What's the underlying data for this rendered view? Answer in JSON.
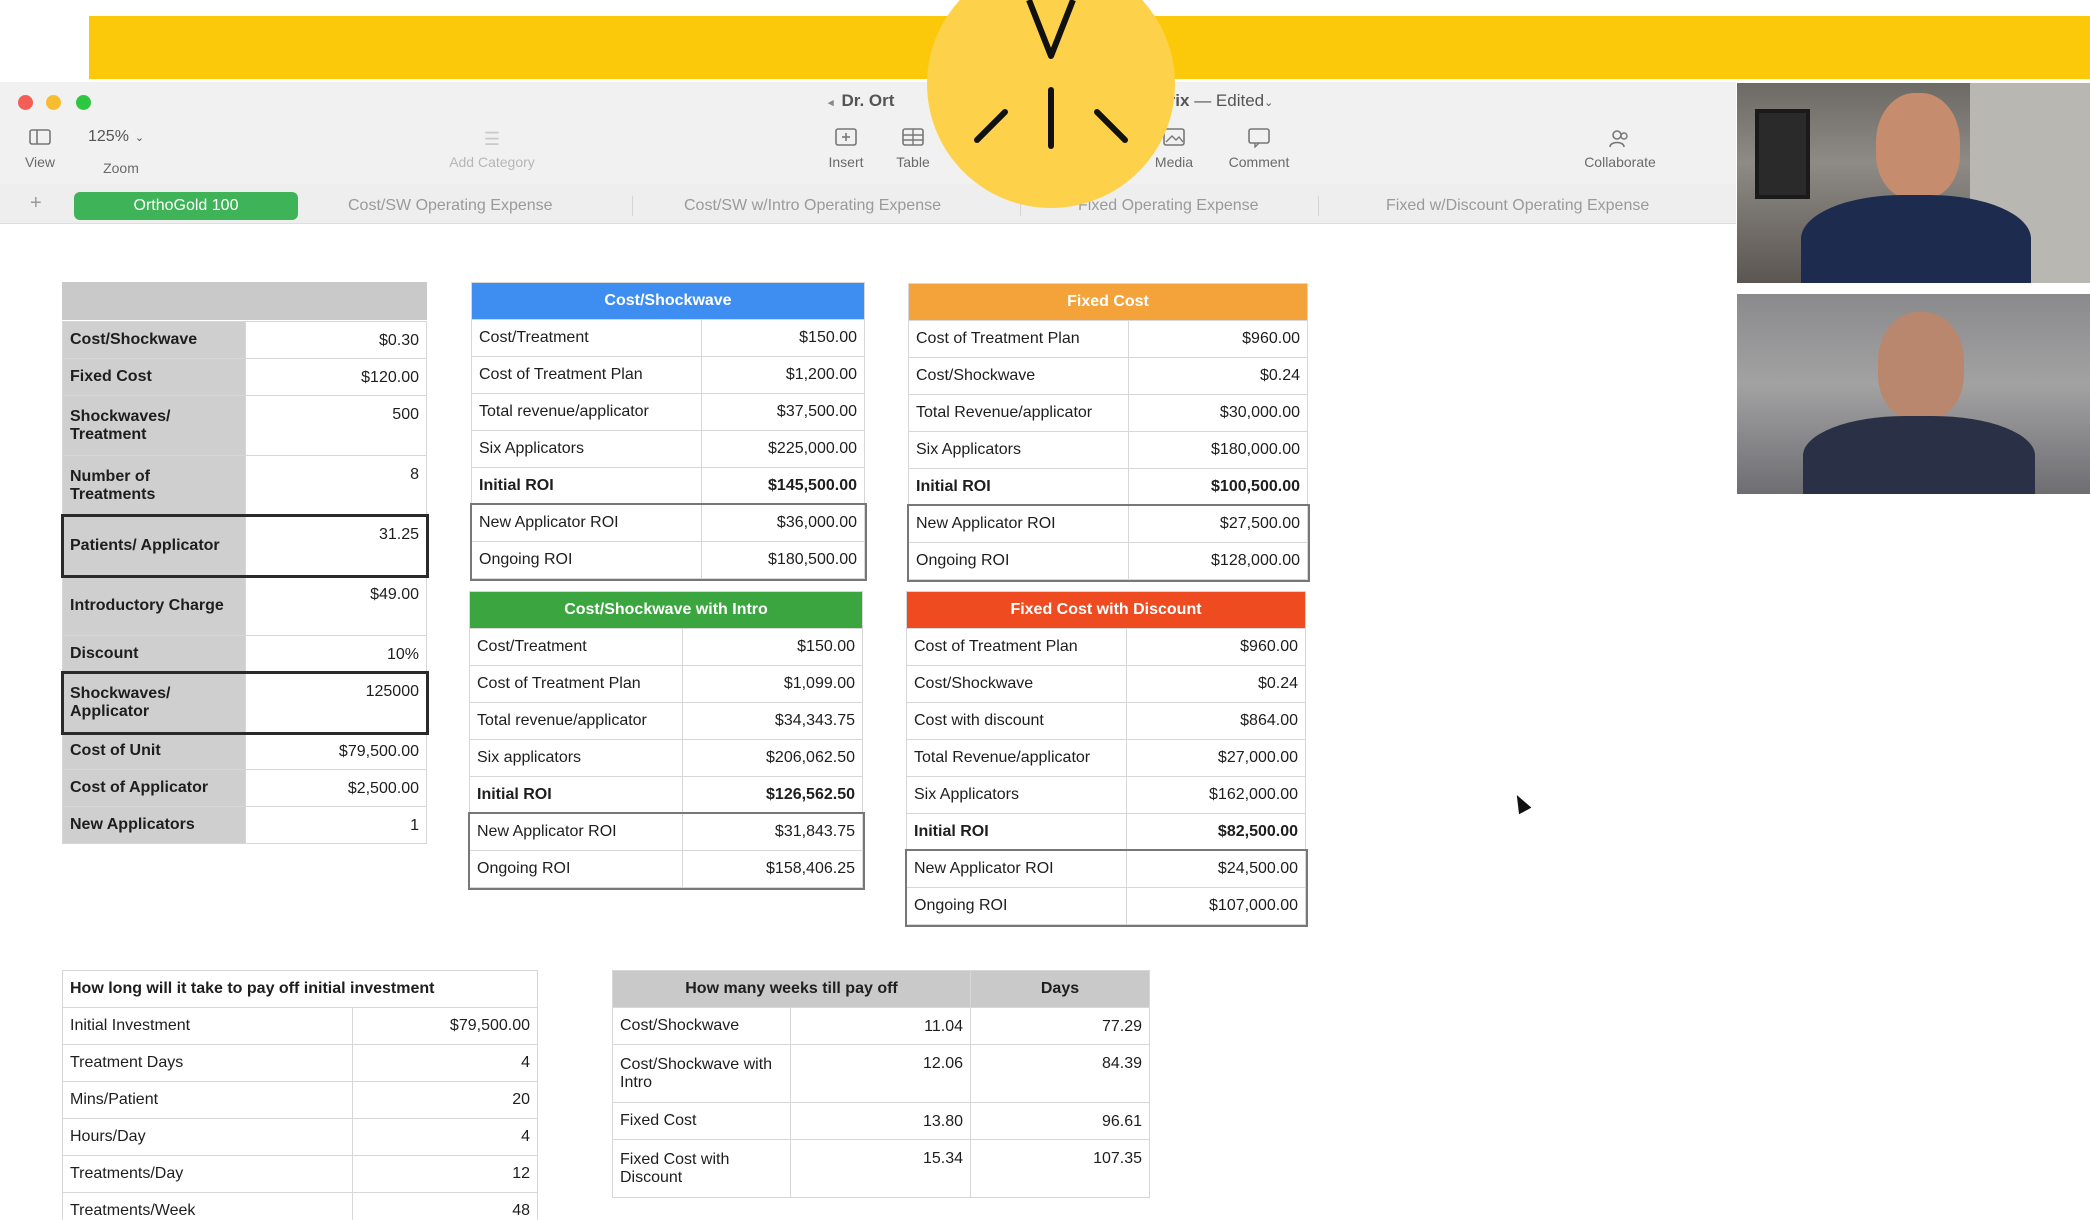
{
  "window": {
    "title_left": "Dr. Ort",
    "title_right_bold": "trix",
    "title_status": "— Edited",
    "toolbar": {
      "view_label": "View",
      "zoom_value": "125%",
      "zoom_label": "Zoom",
      "add_category_label": "Add Category",
      "insert_label": "Insert",
      "table_label": "Table",
      "media_label": "Media",
      "comment_label": "Comment",
      "collaborate_label": "Collaborate"
    },
    "tabs": [
      "OrthoGold 100",
      "Cost/SW Operating Expense",
      "Cost/SW w/Intro Operating Expense",
      "Fixed Operating Expense",
      "Fixed w/Discount Operating Expense"
    ]
  },
  "inputs": {
    "rows": [
      {
        "label": "Cost/Shockwave",
        "value": "$0.30"
      },
      {
        "label": "Fixed Cost",
        "value": "$120.00"
      },
      {
        "label": "Shockwaves/ Treatment",
        "value": "500"
      },
      {
        "label": "Number of Treatments",
        "value": "8"
      },
      {
        "label": "Patients/ Applicator",
        "value": "31.25"
      },
      {
        "label": "Introductory Charge",
        "value": "$49.00"
      },
      {
        "label": "Discount",
        "value": "10%"
      },
      {
        "label": "Shockwaves/ Applicator",
        "value": "125000"
      },
      {
        "label": "Cost of Unit",
        "value": "$79,500.00"
      },
      {
        "label": "Cost of Applicator",
        "value": "$2,500.00"
      },
      {
        "label": "New Applicators",
        "value": "1"
      }
    ]
  },
  "cost_shockwave": {
    "title": "Cost/Shockwave",
    "color": "#3d8ef0",
    "rows": [
      {
        "label": "Cost/Treatment",
        "value": "$150.00"
      },
      {
        "label": "Cost of Treatment Plan",
        "value": "$1,200.00"
      },
      {
        "label": "Total revenue/applicator",
        "value": "$37,500.00"
      },
      {
        "label": "Six Applicators",
        "value": "$225,000.00"
      },
      {
        "label": "Initial ROI",
        "value": "$145,500.00"
      },
      {
        "label": "New Applicator ROI",
        "value": "$36,000.00"
      },
      {
        "label": "Ongoing ROI",
        "value": "$180,500.00"
      }
    ]
  },
  "cost_shockwave_intro": {
    "title": "Cost/Shockwave with Intro",
    "color": "#3ba63f",
    "rows": [
      {
        "label": "Cost/Treatment",
        "value": "$150.00"
      },
      {
        "label": "Cost of Treatment Plan",
        "value": "$1,099.00"
      },
      {
        "label": "Total revenue/applicator",
        "value": "$34,343.75"
      },
      {
        "label": "Six applicators",
        "value": "$206,062.50"
      },
      {
        "label": "Initial ROI",
        "value": "$126,562.50"
      },
      {
        "label": "New Applicator ROI",
        "value": "$31,843.75"
      },
      {
        "label": "Ongoing ROI",
        "value": "$158,406.25"
      }
    ]
  },
  "fixed_cost": {
    "title": "Fixed Cost",
    "color": "#f3a33a",
    "rows": [
      {
        "label": "Cost of Treatment Plan",
        "value": "$960.00"
      },
      {
        "label": "Cost/Shockwave",
        "value": "$0.24"
      },
      {
        "label": "Total Revenue/applicator",
        "value": "$30,000.00"
      },
      {
        "label": "Six Applicators",
        "value": "$180,000.00"
      },
      {
        "label": "Initial ROI",
        "value": "$100,500.00"
      },
      {
        "label": "New Applicator ROI",
        "value": "$27,500.00"
      },
      {
        "label": "Ongoing ROI",
        "value": "$128,000.00"
      }
    ]
  },
  "fixed_cost_discount": {
    "title": "Fixed Cost with Discount",
    "color": "#ef4b21",
    "rows": [
      {
        "label": "Cost of Treatment Plan",
        "value": "$960.00"
      },
      {
        "label": "Cost/Shockwave",
        "value": "$0.24"
      },
      {
        "label": "Cost with discount",
        "value": "$864.00"
      },
      {
        "label": "Total Revenue/applicator",
        "value": "$27,000.00"
      },
      {
        "label": "Six Applicators",
        "value": "$162,000.00"
      },
      {
        "label": "Initial ROI",
        "value": "$82,500.00"
      },
      {
        "label": "New Applicator ROI",
        "value": "$24,500.00"
      },
      {
        "label": "Ongoing ROI",
        "value": "$107,000.00"
      }
    ]
  },
  "payoff": {
    "title": "How long will it take to pay off initial investment",
    "rows": [
      {
        "label": "Initial Investment",
        "value": "$79,500.00"
      },
      {
        "label": "Treatment Days",
        "value": "4"
      },
      {
        "label": "Mins/Patient",
        "value": "20"
      },
      {
        "label": "Hours/Day",
        "value": "4"
      },
      {
        "label": "Treatments/Day",
        "value": "12"
      },
      {
        "label": "Treatments/Week",
        "value": "48"
      }
    ]
  },
  "weeks": {
    "header_weeks": "How many weeks till pay off",
    "header_days": "Days",
    "rows": [
      {
        "label": "Cost/Shockwave",
        "weeks": "11.04",
        "days": "77.29"
      },
      {
        "label": "Cost/Shockwave with Intro",
        "weeks": "12.06",
        "days": "84.39"
      },
      {
        "label": "Fixed Cost",
        "weeks": "13.80",
        "days": "96.61"
      },
      {
        "label": "Fixed Cost with Discount",
        "weeks": "15.34",
        "days": "107.35"
      }
    ]
  },
  "colors": {
    "banner": "#fcc80a",
    "active_tab": "#3fb358",
    "badge": "#fdd24a"
  }
}
